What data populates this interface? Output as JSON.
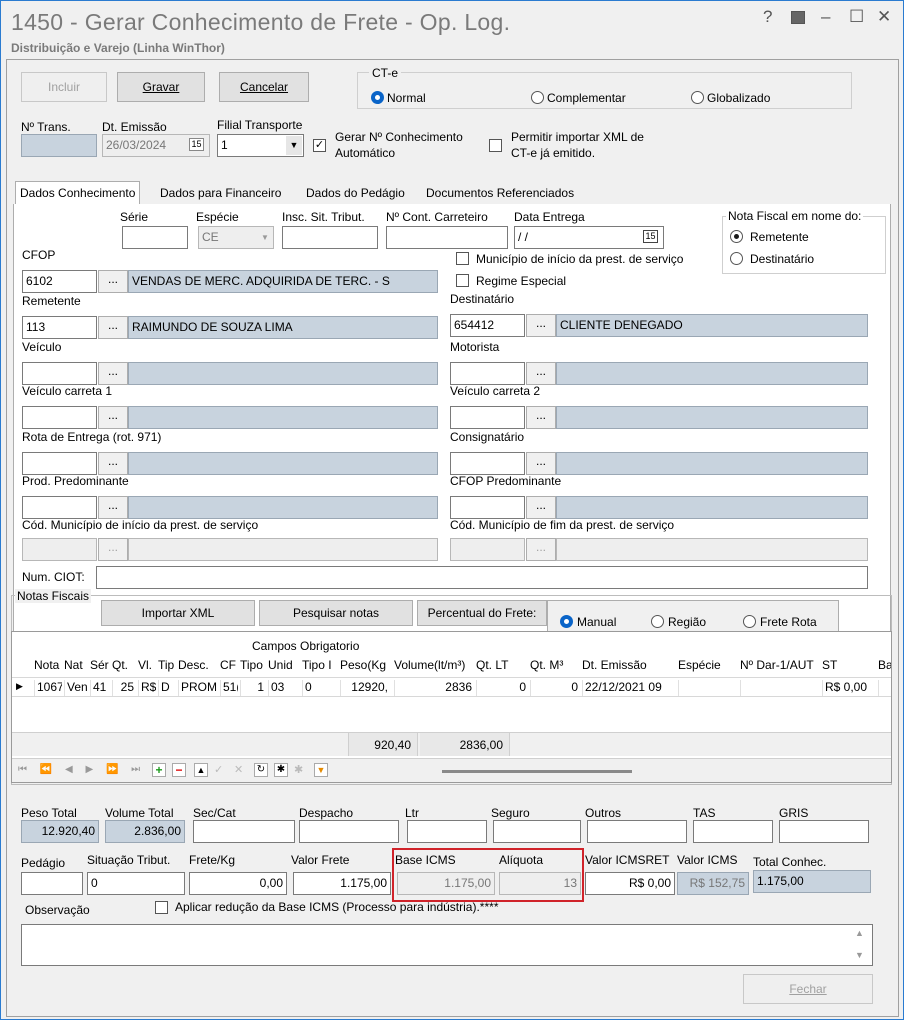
{
  "window": {
    "title": "1450 - Gerar Conhecimento de Frete - Op. Log.",
    "subtitle": "Distribuição e Varejo (Linha WinThor)",
    "help": "?",
    "min": "–",
    "max": "☐",
    "close": "✕"
  },
  "toolbar": {
    "incluir": "Incluir",
    "gravar": "Gravar",
    "cancelar": "Cancelar"
  },
  "cte": {
    "label": "CT-e",
    "normal": "Normal",
    "complementar": "Complementar",
    "globalizado": "Globalizado"
  },
  "header": {
    "ntrans_label": "Nº Trans.",
    "ntrans_value": "",
    "dt_emissao_label": "Dt. Emissão",
    "dt_emissao_value": "26/03/2024",
    "filial_label": "Filial Transporte",
    "filial_value": "1",
    "gerar_label": "Gerar Nº Conhecimento Automático",
    "gerar_line1": "Gerar Nº Conhecimento",
    "gerar_line2": "Automático",
    "permitir_line1": "Permitir importar XML de",
    "permitir_line2": "CT-e já emitido."
  },
  "tabs": [
    "Dados Conhecimento",
    "Dados para Financeiro",
    "Dados do Pedágio",
    "Documentos Referenciados"
  ],
  "dados": {
    "serie_label": "Série",
    "especie_label": "Espécie",
    "especie_value": "CE",
    "insc_label": "Insc. Sit. Tribut.",
    "ncont_label": "Nº Cont. Carreteiro",
    "dataentrega_label": "Data Entrega",
    "dataentrega_value": " / /",
    "nf_nome_label": "Nota Fiscal em nome do:",
    "remetente_opt": "Remetente",
    "destinatario_opt": "Destinatário",
    "cfop_label": "CFOP",
    "cfop_code": "6102",
    "cfop_desc": "VENDAS DE MERC. ADQUIRIDA DE TERC. - S",
    "municipio_inicio_chk": "Município de início da prest. de serviço",
    "regime_especial_chk": "Regime Especial",
    "remetente_label": "Remetente",
    "remetente_code": "113",
    "remetente_name": "RAIMUNDO DE SOUZA LIMA",
    "destinatario_label": "Destinatário",
    "destinatario_code": "654412",
    "destinatario_name": "CLIENTE DENEGADO",
    "veiculo_label": "Veículo",
    "motorista_label": "Motorista",
    "veic_carreta1_label": "Veículo carreta 1",
    "veic_carreta2_label": "Veículo carreta 2",
    "rota_label": "Rota de Entrega (rot. 971)",
    "consignatario_label": "Consignatário",
    "prod_pred_label": "Prod. Predominante",
    "cfop_pred_label": "CFOP Predominante",
    "cod_mun_inicio_label": "Cód. Município de início da prest. de serviço",
    "cod_mun_fim_label": "Cód. Município de fim da prest. de serviço",
    "ciot_label": "Num. CIOT:",
    "dots": "..."
  },
  "notas": {
    "group_label": "Notas Fiscais",
    "importar_xml": "Importar XML",
    "pesquisar_notas": "Pesquisar notas",
    "percentual_label": "Percentual do Frete:",
    "manual": "Manual",
    "regiao": "Região",
    "frete_rota": "Frete Rota",
    "campos_obrig": "Campos Obrigatorio",
    "columns": [
      "Nota",
      "Nat",
      "Sér",
      "Qt.",
      "Vl.",
      "Tip",
      "Desc.",
      "CF",
      "Tipo",
      "Unid",
      "Tipo I",
      "Peso(Kg",
      "Volume(lt/m³)",
      "Qt. LT",
      "Qt. M³",
      "Dt. Emissão",
      "Espécie",
      "Nº Dar-1/AUT",
      "ST",
      "Ba"
    ],
    "row": [
      "1067",
      "Ven",
      "41",
      "25",
      "R$",
      "D",
      "PROM",
      "51(",
      "1",
      "03",
      "0",
      "12920,",
      "2836",
      "0",
      "0",
      "22/12/2021 09",
      "",
      "",
      "R$ 0,00",
      ""
    ],
    "total_peso": "920,40",
    "total_volume": "2836,00"
  },
  "totais": {
    "peso_total_label": "Peso Total",
    "peso_total_value": "12.920,40",
    "volume_total_label": "Volume Total",
    "volume_total_value": "2.836,00",
    "seccat_label": "Sec/Cat",
    "despacho_label": "Despacho",
    "ltr_label": "Ltr",
    "seguro_label": "Seguro",
    "outros_label": "Outros",
    "tas_label": "TAS",
    "gris_label": "GRIS",
    "pedagio_label": "Pedágio",
    "sit_trib_label": "Situação Tribut.",
    "sit_trib_value": "0",
    "frete_kg_label": "Frete/Kg",
    "frete_kg_value": "0,00",
    "valor_frete_label": "Valor Frete",
    "valor_frete_value": "1.175,00",
    "base_icms_label": "Base ICMS",
    "base_icms_value": "1.175,00",
    "aliquota_label": "Alíquota",
    "aliquota_value": "13",
    "valor_icmsret_label": "Valor ICMSRET",
    "valor_icmsret_value": "R$ 0,00",
    "valor_icms_label": "Valor ICMS",
    "valor_icms_value": "R$ 152,75",
    "total_conhec_label": "Total Conhec.",
    "total_conhec_value": "1.175,00",
    "observacao_label": "Observação",
    "aplicar_reducao": "Aplicar redução da Base ICMS (Processo para indústria).****",
    "fechar": "Fechar"
  }
}
